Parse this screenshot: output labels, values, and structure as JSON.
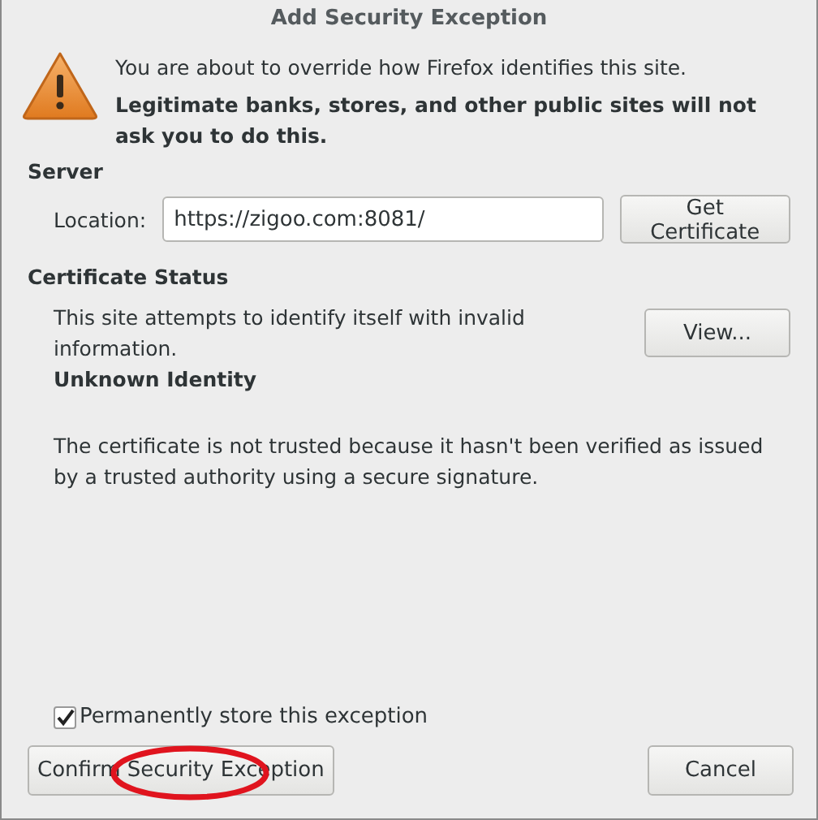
{
  "window": {
    "title": "Add Security Exception"
  },
  "warning": {
    "message": "You are about to override how Firefox identifies this site.",
    "emphasis": "Legitimate banks, stores, and other public sites will not ask you to do this."
  },
  "server": {
    "heading": "Server",
    "location_label": "Location:",
    "location_value": "https://zigoo.com:8081/",
    "get_button": "Get Certificate"
  },
  "certificate_status": {
    "heading": "Certificate Status",
    "description": "This site attempts to identify itself with invalid information.",
    "view_button": "View...",
    "problem_title": "Unknown Identity",
    "problem_text": "The certificate is not trusted because it hasn't been verified as issued by a trusted authority using a secure signature."
  },
  "permanent": {
    "label": "Permanently store this exception",
    "checked": true
  },
  "buttons": {
    "confirm": "Confirm Security Exception",
    "cancel": "Cancel"
  }
}
